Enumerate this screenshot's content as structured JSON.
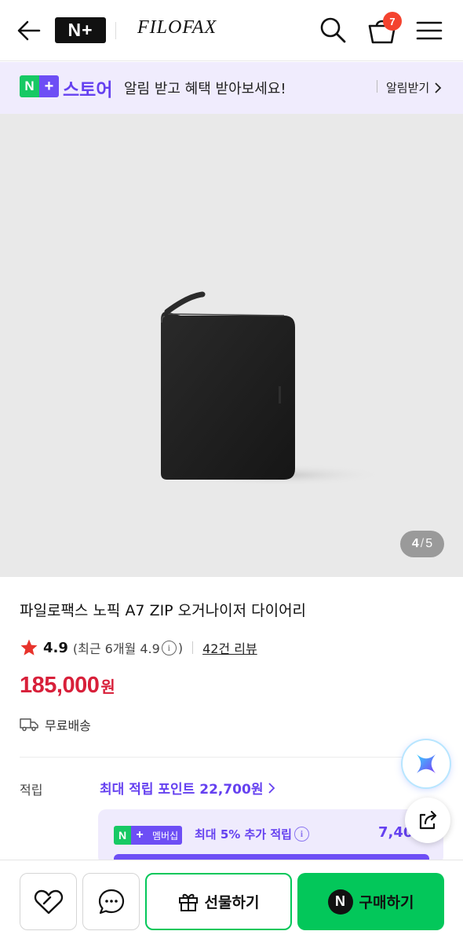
{
  "header": {
    "logo": "N+",
    "brand": "FILOFAX",
    "cart_count": "7",
    "icons": [
      "back-arrow-icon",
      "search-icon",
      "cart-icon",
      "hamburger-menu-icon"
    ]
  },
  "store_banner": {
    "badge_n": "N",
    "badge_plus": "+",
    "store_name": "스토어",
    "message": "알림 받고 혜택 받아보세요!",
    "alarm_label": "알림받기"
  },
  "gallery": {
    "current": "4",
    "separator": "/",
    "total": "5"
  },
  "product": {
    "title": "파일로팩스 노픽 A7 ZIP 오거나이저 다이어리",
    "rating": "4.9",
    "recent_rating": "(최근 6개월 4.9",
    "recent_close": ")",
    "review_count": "42건 리뷰",
    "price": "185,000",
    "price_unit": "원",
    "shipping": "무료배송"
  },
  "points": {
    "label": "적립",
    "value": "최대 적립 포인트 22,700원"
  },
  "membership": {
    "badge_n": "N",
    "badge_plus": "+",
    "badge_text": "멤버십",
    "text": "최대 5% 추가 적립",
    "amount": "7,40"
  },
  "bottom_bar": {
    "gift_label": "선물하기",
    "buy_n": "N",
    "buy_label": "구매하기"
  },
  "colors": {
    "accent_purple": "#6541f0",
    "naver_green": "#03c75a",
    "price_red": "#d8203a",
    "badge_red": "#f4432f"
  }
}
